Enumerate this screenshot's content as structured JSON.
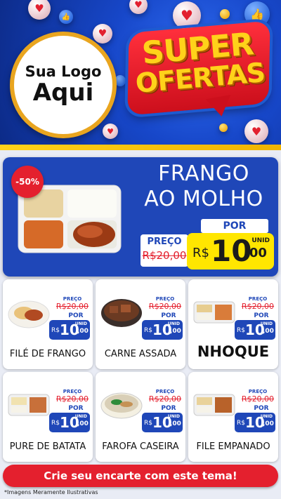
{
  "brand": {
    "logo_line1": "Sua Logo",
    "logo_line2": "Aqui",
    "badge_line1": "SUPER",
    "badge_line2": "OFERTAS"
  },
  "colors": {
    "primary_blue": "#1f47b8",
    "accent_red": "#e4202e",
    "highlight_yellow": "#ffe600"
  },
  "featured": {
    "discount": "-50%",
    "title_line1": "FRANGO",
    "title_line2": "AO MOLHO",
    "price_label": "PREÇO",
    "old_price": "R$20,00",
    "por_label": "POR",
    "unit_label": "UNID",
    "currency": "R$",
    "price_int": "10",
    "price_cents": ",00"
  },
  "products": [
    {
      "name": "FILÉ DE FRANGO",
      "price_label": "PREÇO",
      "old_price": "R$20,00",
      "por_label": "POR",
      "unit_label": "UNID",
      "currency": "R$",
      "price_int": "10",
      "price_cents": ",00"
    },
    {
      "name": "CARNE ASSADA",
      "price_label": "PREÇO",
      "old_price": "R$20,00",
      "por_label": "POR",
      "unit_label": "UNID",
      "currency": "R$",
      "price_int": "10",
      "price_cents": ",00"
    },
    {
      "name": "NHOQUE",
      "price_label": "PREÇO",
      "old_price": "R$20,00",
      "por_label": "POR",
      "unit_label": "UNID",
      "currency": "R$",
      "price_int": "10",
      "price_cents": ",00"
    },
    {
      "name": "PURE DE BATATA",
      "price_label": "PREÇO",
      "old_price": "R$20,00",
      "por_label": "POR",
      "unit_label": "UNID",
      "currency": "R$",
      "price_int": "10",
      "price_cents": ",00"
    },
    {
      "name": "FAROFA CASEIRA",
      "price_label": "PREÇO",
      "old_price": "R$20,00",
      "por_label": "POR",
      "unit_label": "UNID",
      "currency": "R$",
      "price_int": "10",
      "price_cents": ",00"
    },
    {
      "name": "FILE EMPANADO",
      "price_label": "PREÇO",
      "old_price": "R$20,00",
      "por_label": "POR",
      "unit_label": "UNID",
      "currency": "R$",
      "price_int": "10",
      "price_cents": ",00"
    }
  ],
  "cta": {
    "label": "Crie seu encarte com este tema!"
  },
  "footer": {
    "disclaimer": "*Imagens Meramente Ilustrativas"
  }
}
